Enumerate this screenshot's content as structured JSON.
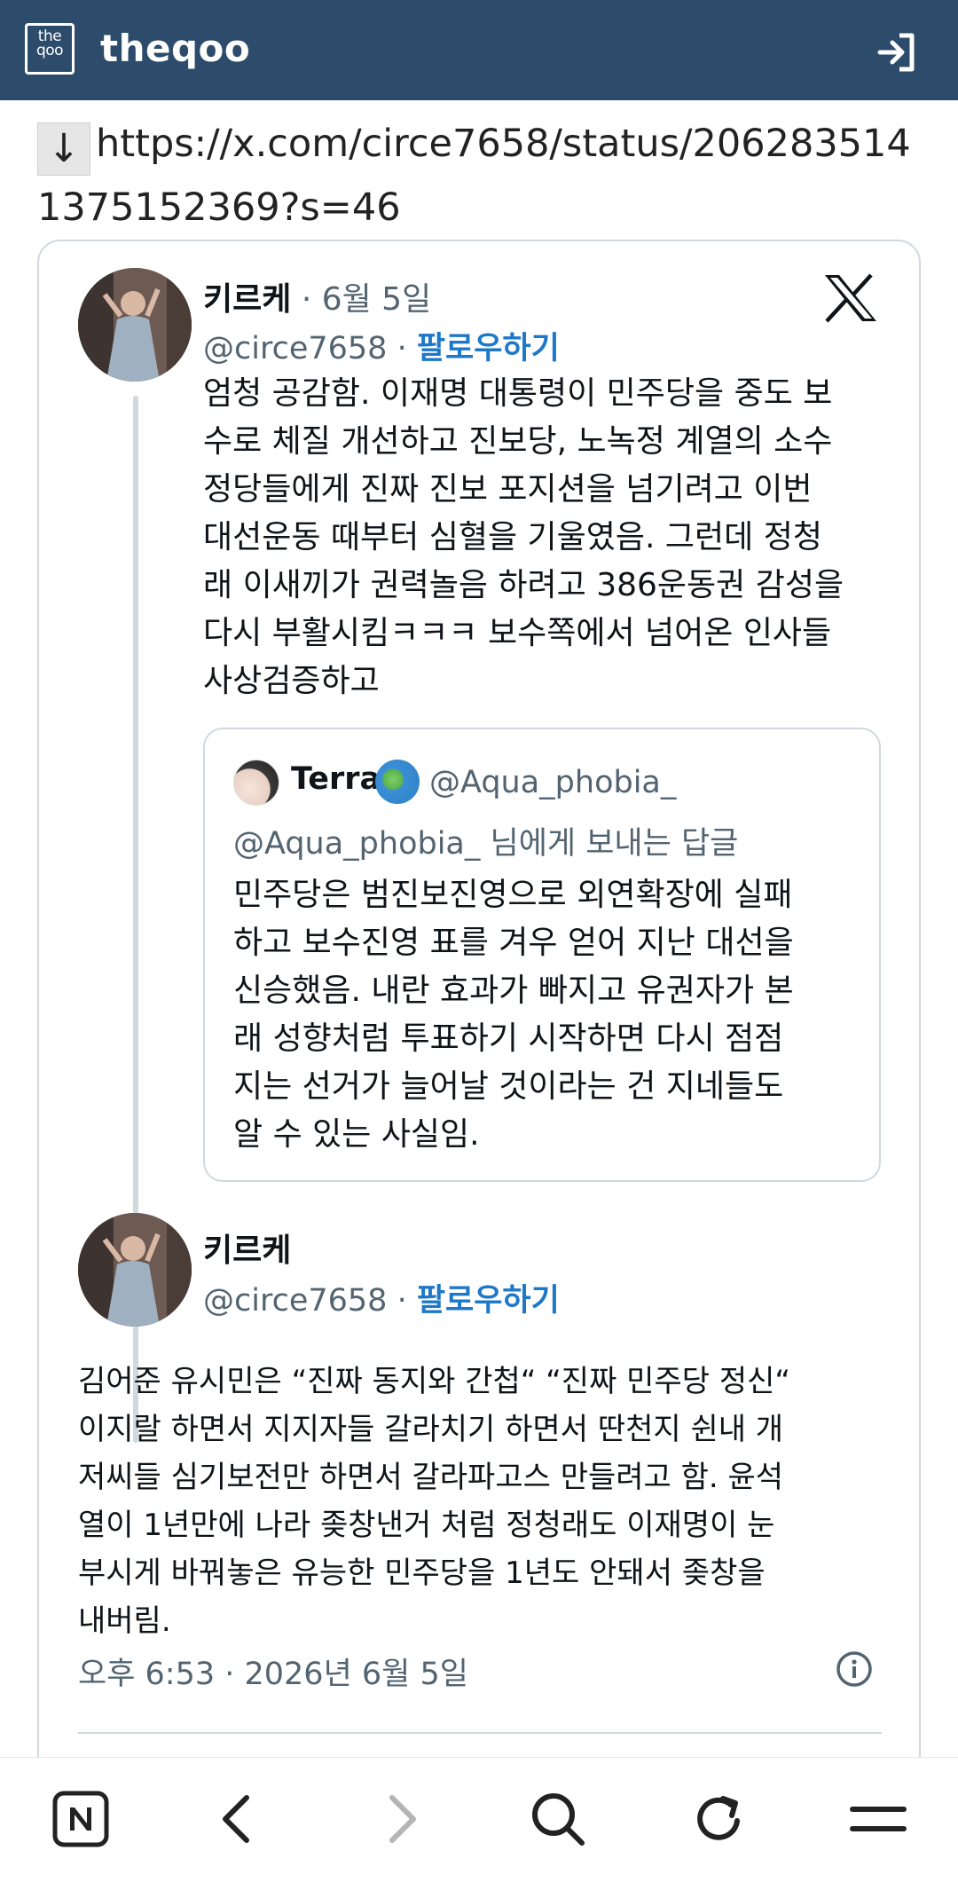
{
  "header": {
    "site_name": "theqoo",
    "logo_top": "the",
    "logo_bottom": "qoo",
    "login_icon": "login-icon"
  },
  "link": {
    "arrow": "↓",
    "url": "https://x.com/circe7658/status/2062835141375152369?s=46"
  },
  "tweet1": {
    "name": "키르케",
    "date": " · 6월 5일",
    "handle": "@circe7658",
    "sep": " · ",
    "follow": "팔로우하기",
    "text": "엄청 공감함. 이재명 대통령이 민주당을 중도 보\n수로 체질 개선하고 진보당, 노녹정 계열의 소수\n정당들에게 진짜 진보 포지션을 넘기려고 이번\n대선운동 때부터 심혈을 기울였음. 그런데 정청\n래 이새끼가 권력놀음 하려고 386운동권 감성을\n다시 부활시킴ㅋㅋㅋ 보수쪽에서 넘어온 인사들\n사상검증하고",
    "quote": {
      "name": "Terra",
      "handle": "@Aqua_phobia_",
      "replying": "@Aqua_phobia_ 님에게 보내는 답글",
      "text": "민주당은 범진보진영으로 외연확장에 실패\n하고 보수진영 표를 겨우 얻어 지난 대선을\n신승했음. 내란 효과가 빠지고 유권자가 본\n래 성향처럼 투표하기 시작하면 다시 점점\n지는 선거가 늘어날 것이라는 건 지네들도\n알 수 있는 사실임."
    }
  },
  "tweet2": {
    "name": "키르케",
    "handle": "@circe7658",
    "sep": " · ",
    "follow": "팔로우하기",
    "text": "김어준 유시민은 “진짜 동지와 간첩“ “진짜 민주당 정신“\n이지랄 하면서 지지자들 갈라치기 하면서 딴천지 쉰내 개\n저씨들 심기보전만 하면서 갈라파고스 만들려고 함. 윤석\n열이 1년만에 나라 좆창낸거 처럼 정청래도 이재명이 눈\n부시게 바꿔놓은 유능한 민주당을 1년도 안돼서 좆창을\n내버림.",
    "timestamp": "오후 6:53 · 2026년 6월 5일"
  },
  "icons": {
    "x_logo": "x-logo-icon",
    "info": "info-icon",
    "nav": [
      "naver-icon",
      "back-icon",
      "forward-icon",
      "search-icon",
      "refresh-icon",
      "menu-icon"
    ]
  },
  "colors": {
    "header_bg": "#2d4b6b",
    "follow": "#1d78c9",
    "gray": "#536471",
    "border": "#cfd9de"
  }
}
